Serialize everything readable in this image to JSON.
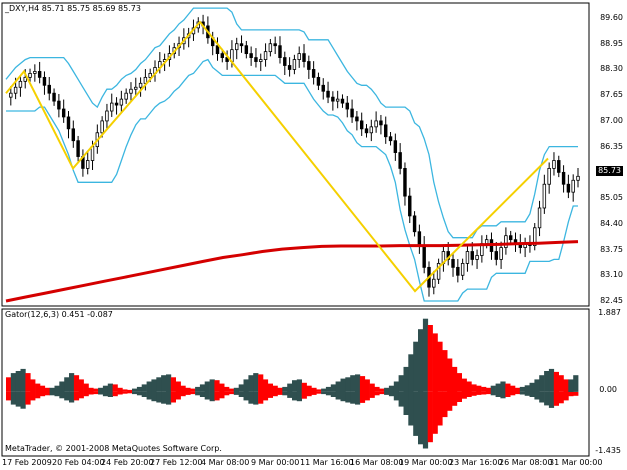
{
  "header": {
    "symbol_line": "_DXY,H4  85.71 85.75 85.69 85.73"
  },
  "price_axis": {
    "labels": [
      "89.60",
      "88.95",
      "88.30",
      "87.65",
      "87.00",
      "86.35",
      "85.73",
      "85.05",
      "84.40",
      "83.75",
      "83.10",
      "82.45"
    ],
    "current": "85.73"
  },
  "indicator": {
    "title": "Gator(12,6,3) 0.451 -0.087",
    "axis_labels": [
      "1.887",
      "0.00",
      "-1.435"
    ],
    "copyright": "MetaTrader, © 2001-2008 MetaQuotes Software Corp."
  },
  "time_axis": [
    "17 Feb 2009",
    "20 Feb 04:00",
    "24 Feb 20:00",
    "27 Feb 12:00",
    "4 Mar 08:00",
    "9 Mar 00:00",
    "11 Mar 16:00",
    "16 Mar 08:00",
    "19 Mar 00:00",
    "23 Mar 16:00",
    "26 Mar 08:00",
    "31 Mar 00:00"
  ],
  "colors": {
    "band": "#3cb6e0",
    "zigzag": "#f5d000",
    "ma": "#d40000",
    "gator_red": "#ff0000",
    "gator_gray": "#2f4f4f",
    "frame": "#000000"
  },
  "chart_data": [
    {
      "type": "line",
      "title": "_DXY,H4",
      "ylim": [
        82.45,
        89.6
      ],
      "series": [
        {
          "values": [
            87.6,
            87.7,
            87.85,
            88.0,
            88.1,
            88.2,
            88.25,
            88.1,
            87.9,
            87.7,
            87.5,
            87.3,
            87.1,
            86.8,
            86.5,
            86.1,
            85.8,
            86.0,
            86.35,
            86.7,
            87.0,
            87.25,
            87.45,
            87.4,
            87.55,
            87.7,
            87.8,
            87.85,
            87.95,
            88.1,
            88.2,
            88.35,
            88.5,
            88.55,
            88.7,
            88.85,
            88.95,
            89.1,
            89.2,
            89.35,
            89.5,
            89.4,
            89.1,
            88.9,
            88.7,
            88.6,
            88.5,
            88.8,
            88.95,
            88.9,
            88.7,
            88.6,
            88.5,
            88.55,
            88.75,
            88.95,
            88.9,
            88.6,
            88.4,
            88.3,
            88.55,
            88.7,
            88.5,
            88.3,
            88.1,
            87.9,
            87.75,
            87.6,
            87.5,
            87.55,
            87.45,
            87.3,
            87.1,
            87.0,
            86.8,
            86.7,
            86.85,
            87.0,
            86.9,
            86.6,
            86.5,
            86.2,
            85.8,
            85.1,
            84.6,
            84.2,
            83.85,
            83.3,
            82.8,
            83.0,
            83.4,
            83.7,
            83.5,
            83.3,
            83.1,
            83.4,
            83.7,
            83.5,
            83.6,
            83.9,
            84.0,
            83.7,
            83.5,
            83.8,
            84.1,
            84.0,
            83.9,
            83.8,
            83.9,
            83.85,
            84.3,
            84.8,
            85.4,
            85.8,
            86.0,
            85.7,
            85.4,
            85.2,
            85.5,
            85.6
          ]
        },
        {
          "values": [
            82.45,
            82.55,
            82.65,
            82.75,
            82.85,
            82.95,
            83.05,
            83.15,
            83.25,
            83.35,
            83.45,
            83.55,
            83.62,
            83.7,
            83.76,
            83.8,
            83.83,
            83.84,
            83.84,
            83.84,
            83.85,
            83.85,
            83.85,
            83.86,
            83.87,
            83.88,
            83.9,
            83.91,
            83.93,
            83.95
          ]
        },
        {
          "x": [
            "17 Feb 2009",
            "19 Feb",
            "20 Feb 04:00",
            "27 Feb 12:00",
            "19 Mar 00:00",
            "31 Mar"
          ],
          "values": [
            87.7,
            88.25,
            85.8,
            89.5,
            82.7,
            86.05
          ]
        }
      ]
    },
    {
      "type": "bar",
      "title": "Gator(12,6,3) 0.451 -0.087",
      "ylim": [
        -1.435,
        1.887
      ],
      "series": [
        {
          "values": [
            0.35,
            0.45,
            0.5,
            0.55,
            0.45,
            0.3,
            0.2,
            0.15,
            0.1,
            0.1,
            0.15,
            0.25,
            0.35,
            0.45,
            0.4,
            0.3,
            0.2,
            0.1,
            0.08,
            0.1,
            0.15,
            0.2,
            0.18,
            0.1,
            0.06,
            0.05,
            0.08,
            0.12,
            0.18,
            0.25,
            0.3,
            0.35,
            0.4,
            0.42,
            0.35,
            0.25,
            0.15,
            0.1,
            0.08,
            0.12,
            0.18,
            0.25,
            0.3,
            0.28,
            0.2,
            0.12,
            0.08,
            0.1,
            0.18,
            0.3,
            0.4,
            0.45,
            0.42,
            0.3,
            0.2,
            0.15,
            0.1,
            0.12,
            0.2,
            0.28,
            0.3,
            0.22,
            0.15,
            0.1,
            0.06,
            0.08,
            0.12,
            0.18,
            0.25,
            0.32,
            0.35,
            0.4,
            0.42,
            0.38,
            0.3,
            0.2,
            0.12,
            0.08,
            0.1,
            0.15,
            0.25,
            0.4,
            0.6,
            0.9,
            1.2,
            1.5,
            1.75,
            1.6,
            1.4,
            1.2,
            1.0,
            0.8,
            0.6,
            0.45,
            0.32,
            0.25,
            0.18,
            0.15,
            0.12,
            0.1,
            0.15,
            0.2,
            0.25,
            0.2,
            0.15,
            0.1,
            0.12,
            0.16,
            0.22,
            0.3,
            0.4,
            0.5,
            0.55,
            0.48,
            0.4,
            0.3,
            0.3,
            0.4
          ]
        },
        {
          "values": [
            -0.2,
            -0.3,
            -0.35,
            -0.4,
            -0.3,
            -0.2,
            -0.15,
            -0.1,
            -0.08,
            -0.08,
            -0.1,
            -0.15,
            -0.2,
            -0.25,
            -0.2,
            -0.15,
            -0.1,
            -0.06,
            -0.05,
            -0.06,
            -0.1,
            -0.12,
            -0.1,
            -0.06,
            -0.04,
            -0.03,
            -0.05,
            -0.08,
            -0.12,
            -0.18,
            -0.22,
            -0.25,
            -0.28,
            -0.3,
            -0.25,
            -0.18,
            -0.1,
            -0.07,
            -0.05,
            -0.08,
            -0.12,
            -0.18,
            -0.22,
            -0.2,
            -0.15,
            -0.08,
            -0.05,
            -0.07,
            -0.12,
            -0.2,
            -0.28,
            -0.3,
            -0.28,
            -0.2,
            -0.14,
            -0.1,
            -0.07,
            -0.08,
            -0.14,
            -0.2,
            -0.22,
            -0.16,
            -0.1,
            -0.07,
            -0.04,
            -0.05,
            -0.08,
            -0.12,
            -0.18,
            -0.22,
            -0.25,
            -0.28,
            -0.3,
            -0.26,
            -0.2,
            -0.14,
            -0.08,
            -0.05,
            -0.07,
            -0.1,
            -0.2,
            -0.35,
            -0.55,
            -0.8,
            -1.05,
            -1.25,
            -1.35,
            -1.2,
            -1.0,
            -0.8,
            -0.6,
            -0.45,
            -0.33,
            -0.24,
            -0.16,
            -0.12,
            -0.09,
            -0.07,
            -0.06,
            -0.05,
            -0.08,
            -0.12,
            -0.15,
            -0.12,
            -0.08,
            -0.05,
            -0.06,
            -0.09,
            -0.12,
            -0.18,
            -0.25,
            -0.32,
            -0.38,
            -0.33,
            -0.27,
            -0.2,
            -0.1,
            -0.09
          ]
        }
      ]
    }
  ]
}
